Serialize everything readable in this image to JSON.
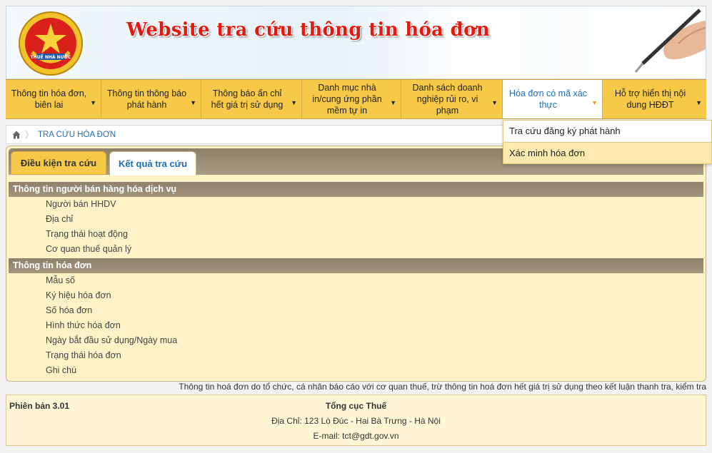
{
  "header": {
    "emblem_text": "THUẾ NHÀ NƯỚC",
    "title": "Website tra cứu thông tin hóa đơn"
  },
  "menu": [
    {
      "label": "Thông tin hóa đơn, biên lai",
      "active": false
    },
    {
      "label": "Thông tin thông báo phát hành",
      "active": false
    },
    {
      "label": "Thông báo ấn chỉ hết giá trị sử dụng",
      "active": false
    },
    {
      "label": "Danh mục nhà in/cung ứng phần mềm tự in",
      "active": false
    },
    {
      "label": "Danh sách doanh nghiệp rủi ro, vi phạm",
      "active": false
    },
    {
      "label": "Hóa đơn có mã xác thực",
      "active": true
    },
    {
      "label": "Hỗ trợ hiển thị nội dung HĐĐT",
      "active": false
    }
  ],
  "dropdown": {
    "items": [
      "Tra cứu đăng ký phát hành",
      "Xác minh hóa đơn"
    ],
    "highlighted": 1
  },
  "breadcrumb": {
    "current": "TRA CỨU HÓA ĐƠN"
  },
  "tabs": {
    "search_conditions": "Điều kiện tra cứu",
    "search_results": "Kết quả tra cứu"
  },
  "sections": {
    "seller": {
      "title": "Thông tin người bán hàng hóa dịch vụ",
      "rows": [
        "Người bán HHDV",
        "Địa chỉ",
        "Trạng thái hoạt động",
        "Cơ quan thuế quản lý"
      ]
    },
    "invoice": {
      "title": "Thông tin hóa đơn",
      "rows": [
        "Mẫu số",
        "Ký hiệu hóa đơn",
        "Số hóa đơn",
        "Hình thức hóa đơn",
        "Ngày bắt đầu sử dụng/Ngày mua",
        "Trạng thái hóa đơn",
        "Ghi chú"
      ]
    }
  },
  "note": "Thông tin hoá đơn do tổ chức, cá nhân báo cáo với cơ quan thuế, trừ thông tin hoá đơn hết giá trị sử dụng theo kết luận thanh tra, kiểm tra",
  "footer": {
    "version": "Phiên bản 3.01",
    "org": "Tổng cục Thuế",
    "address": "Địa Chỉ: 123 Lò Đúc - Hai Bà Trưng - Hà Nội",
    "email": "E-mail: tct@gdt.gov.vn"
  },
  "colors": {
    "menu_bg": "#f7c948",
    "active_menu_text": "#1f6db3",
    "panel_bg": "#fff2c7",
    "section_head": "#968a73",
    "title_red": "#e01b12"
  }
}
